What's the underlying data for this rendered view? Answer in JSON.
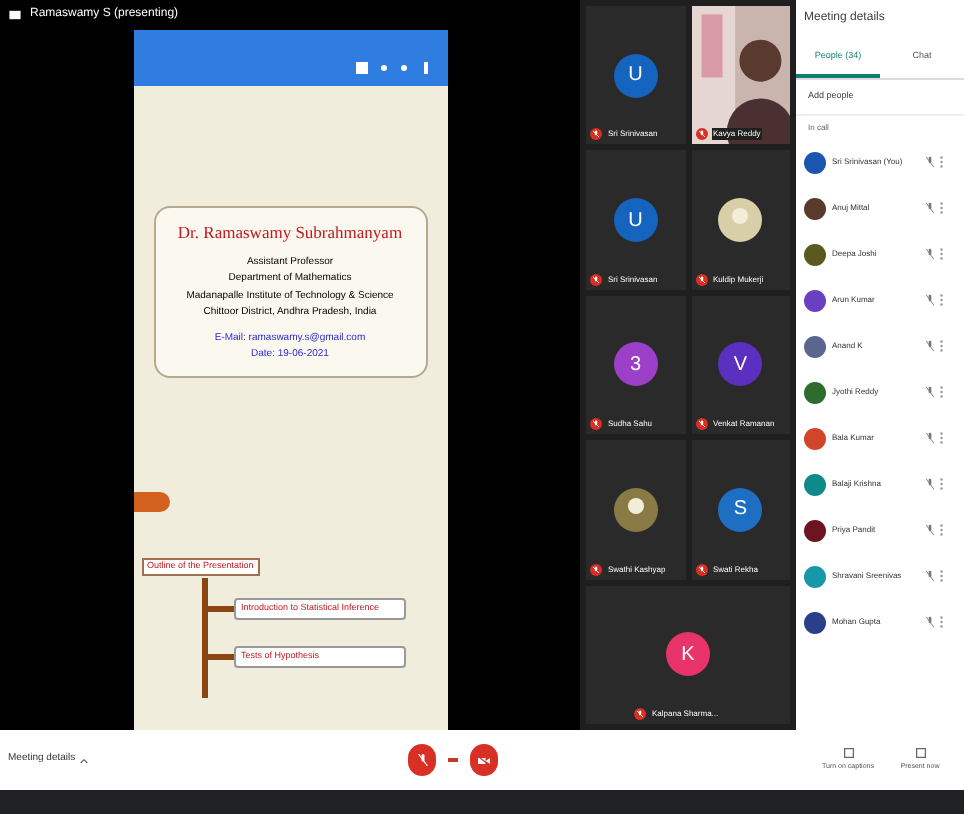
{
  "presenter_label": "Ramaswamy S (presenting)",
  "slide": {
    "name": "Dr. Ramaswamy Subrahmanyam",
    "lines": [
      "Assistant Professor",
      "Department of Mathematics",
      "Madanapalle Institute of Technology & Science",
      "Chittoor District, Andhra Pradesh, India"
    ],
    "email": "E-Mail: ramaswamy.s@gmail.com",
    "date": "Date: 19-06-2021",
    "outline_title": "Outline of the Presentation",
    "outline_items": [
      "Introduction to Statistical Inference",
      "Tests of Hypothesis"
    ]
  },
  "tiles": [
    {
      "kind": "avatar",
      "initial": "U",
      "color": "#1565c0",
      "name": "Sri Srinivasan"
    },
    {
      "kind": "video",
      "name": "Kavya Reddy"
    },
    {
      "kind": "avatar",
      "initial": "U",
      "color": "#1565c0",
      "name": "Sri Srinivasan"
    },
    {
      "color": "#d8cfa8",
      "name": "Kuldip Mukerji"
    },
    {
      "kind": "avatar",
      "initial": "3",
      "color": "#9c3fc9",
      "name": "Sudha Sahu"
    },
    {
      "kind": "avatar",
      "initial": "V",
      "color": "#5b2fbf",
      "name": "Venkat Ramanan"
    },
    {
      "color": "#8a7a45",
      "name": "Swathi Kashyap"
    },
    {
      "kind": "avatar",
      "initial": "S",
      "color": "#1e6fc4",
      "name": "Swati Rekha"
    },
    {
      "kind": "avatar",
      "initial": "K",
      "color": "#e8336b",
      "name": "Kalpana Sharma..."
    }
  ],
  "panel": {
    "title": "Meeting details",
    "tabs": [
      {
        "label": "People (34)",
        "selected": true
      },
      {
        "label": "Chat",
        "selected": false
      }
    ],
    "add_people": "Add people",
    "section": "In call",
    "people": [
      {
        "name": "Sri Srinivasan (You)",
        "color": "#1a56b0"
      },
      {
        "name": "Anuj Mittal",
        "color": "#5a3a2a"
      },
      {
        "name": "Deepa Joshi",
        "color": "#5a5a1e"
      },
      {
        "name": "Arun Kumar",
        "color": "#6a3fc0"
      },
      {
        "name": "Anand K",
        "color": "#5a6690"
      },
      {
        "name": "Jyothi Reddy",
        "color": "#2e6b2e"
      },
      {
        "name": "Bala Kumar",
        "color": "#d2452a"
      },
      {
        "name": "Balaji Krishna",
        "color": "#0f8a8a"
      },
      {
        "name": "Priya Pandit",
        "color": "#6e1420"
      },
      {
        "name": "Shravani Sreenivas",
        "color": "#1798a8"
      },
      {
        "name": "Mohan Gupta",
        "color": "#2a3f8a"
      }
    ]
  },
  "bottom_bar": {
    "details": "Meeting details",
    "actions": [
      "Turn on captions",
      "Present now"
    ]
  }
}
